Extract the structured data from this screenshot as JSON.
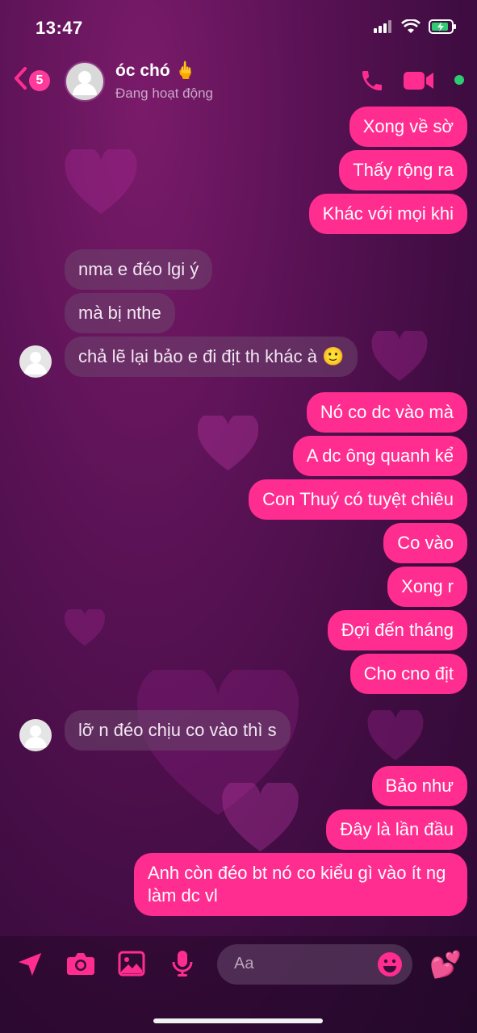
{
  "status_bar": {
    "time": "13:47"
  },
  "header": {
    "back_count": "5",
    "contact_name": "óc chó 🖕",
    "contact_status": "Đang hoạt động"
  },
  "messages": [
    {
      "dir": "out",
      "text": "Xong về sờ"
    },
    {
      "dir": "out",
      "text": "Thấy rộng ra"
    },
    {
      "dir": "out",
      "text": "Khác với mọi khi"
    },
    {
      "dir": "in",
      "text": "nma e đéo lgi ý"
    },
    {
      "dir": "in",
      "text": "mà bị nthe"
    },
    {
      "dir": "in",
      "text": "chả lẽ lại bảo e đi địt th khác à 🙂"
    },
    {
      "dir": "out",
      "text": "Nó co dc vào mà"
    },
    {
      "dir": "out",
      "text": "A dc ông quanh kể"
    },
    {
      "dir": "out",
      "text": "Con Thuý có tuyệt chiêu"
    },
    {
      "dir": "out",
      "text": "Co vào"
    },
    {
      "dir": "out",
      "text": "Xong r"
    },
    {
      "dir": "out",
      "text": "Đợi đến tháng"
    },
    {
      "dir": "out",
      "text": "Cho cno địt"
    },
    {
      "dir": "in",
      "text": "lỡ n đéo chịu co vào thì s"
    },
    {
      "dir": "out",
      "text": "Bảo như"
    },
    {
      "dir": "out",
      "text": "Đây là lần đầu"
    },
    {
      "dir": "out",
      "text": "Anh còn đéo bt nó co kiểu gì vào ít ng làm dc vl"
    }
  ],
  "composer": {
    "placeholder": "Aa",
    "like_icon": "💕"
  },
  "colors": {
    "accent": "#ff2d8f",
    "incoming_bubble": "#6e466e",
    "online": "#2ecc71"
  }
}
